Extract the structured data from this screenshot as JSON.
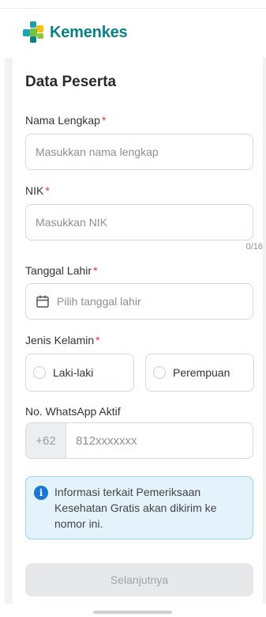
{
  "brand": {
    "name": "Kemenkes"
  },
  "form": {
    "title": "Data Peserta",
    "required_mark": "*",
    "nama": {
      "label": "Nama Lengkap",
      "placeholder": "Masukkan nama lengkap"
    },
    "nik": {
      "label": "NIK",
      "placeholder": "Masukkan NIK",
      "counter": "0/16"
    },
    "tanggal": {
      "label": "Tanggal Lahir",
      "placeholder": "Pilih tanggal lahir",
      "icon": "calendar-icon"
    },
    "gender": {
      "label": "Jenis Kelamin",
      "options": [
        "Laki-laki",
        "Perempuan"
      ]
    },
    "whatsapp": {
      "label": "No. WhatsApp Aktif",
      "country_code": "+62",
      "placeholder": "812xxxxxxx"
    },
    "info": {
      "icon": "info-icon",
      "text": "Informasi terkait Pemeriksaan Kesehatan Gratis akan dikirim ke nomor ini."
    },
    "submit": {
      "label": "Selanjutnya",
      "enabled": false
    }
  },
  "colors": {
    "brand_teal": "#0a7f86",
    "required": "#e53935",
    "info_bg": "#e3f2fb",
    "info_border": "#9fd2ef",
    "info_icon": "#1976d2",
    "button_disabled": "#e7e8ea"
  }
}
